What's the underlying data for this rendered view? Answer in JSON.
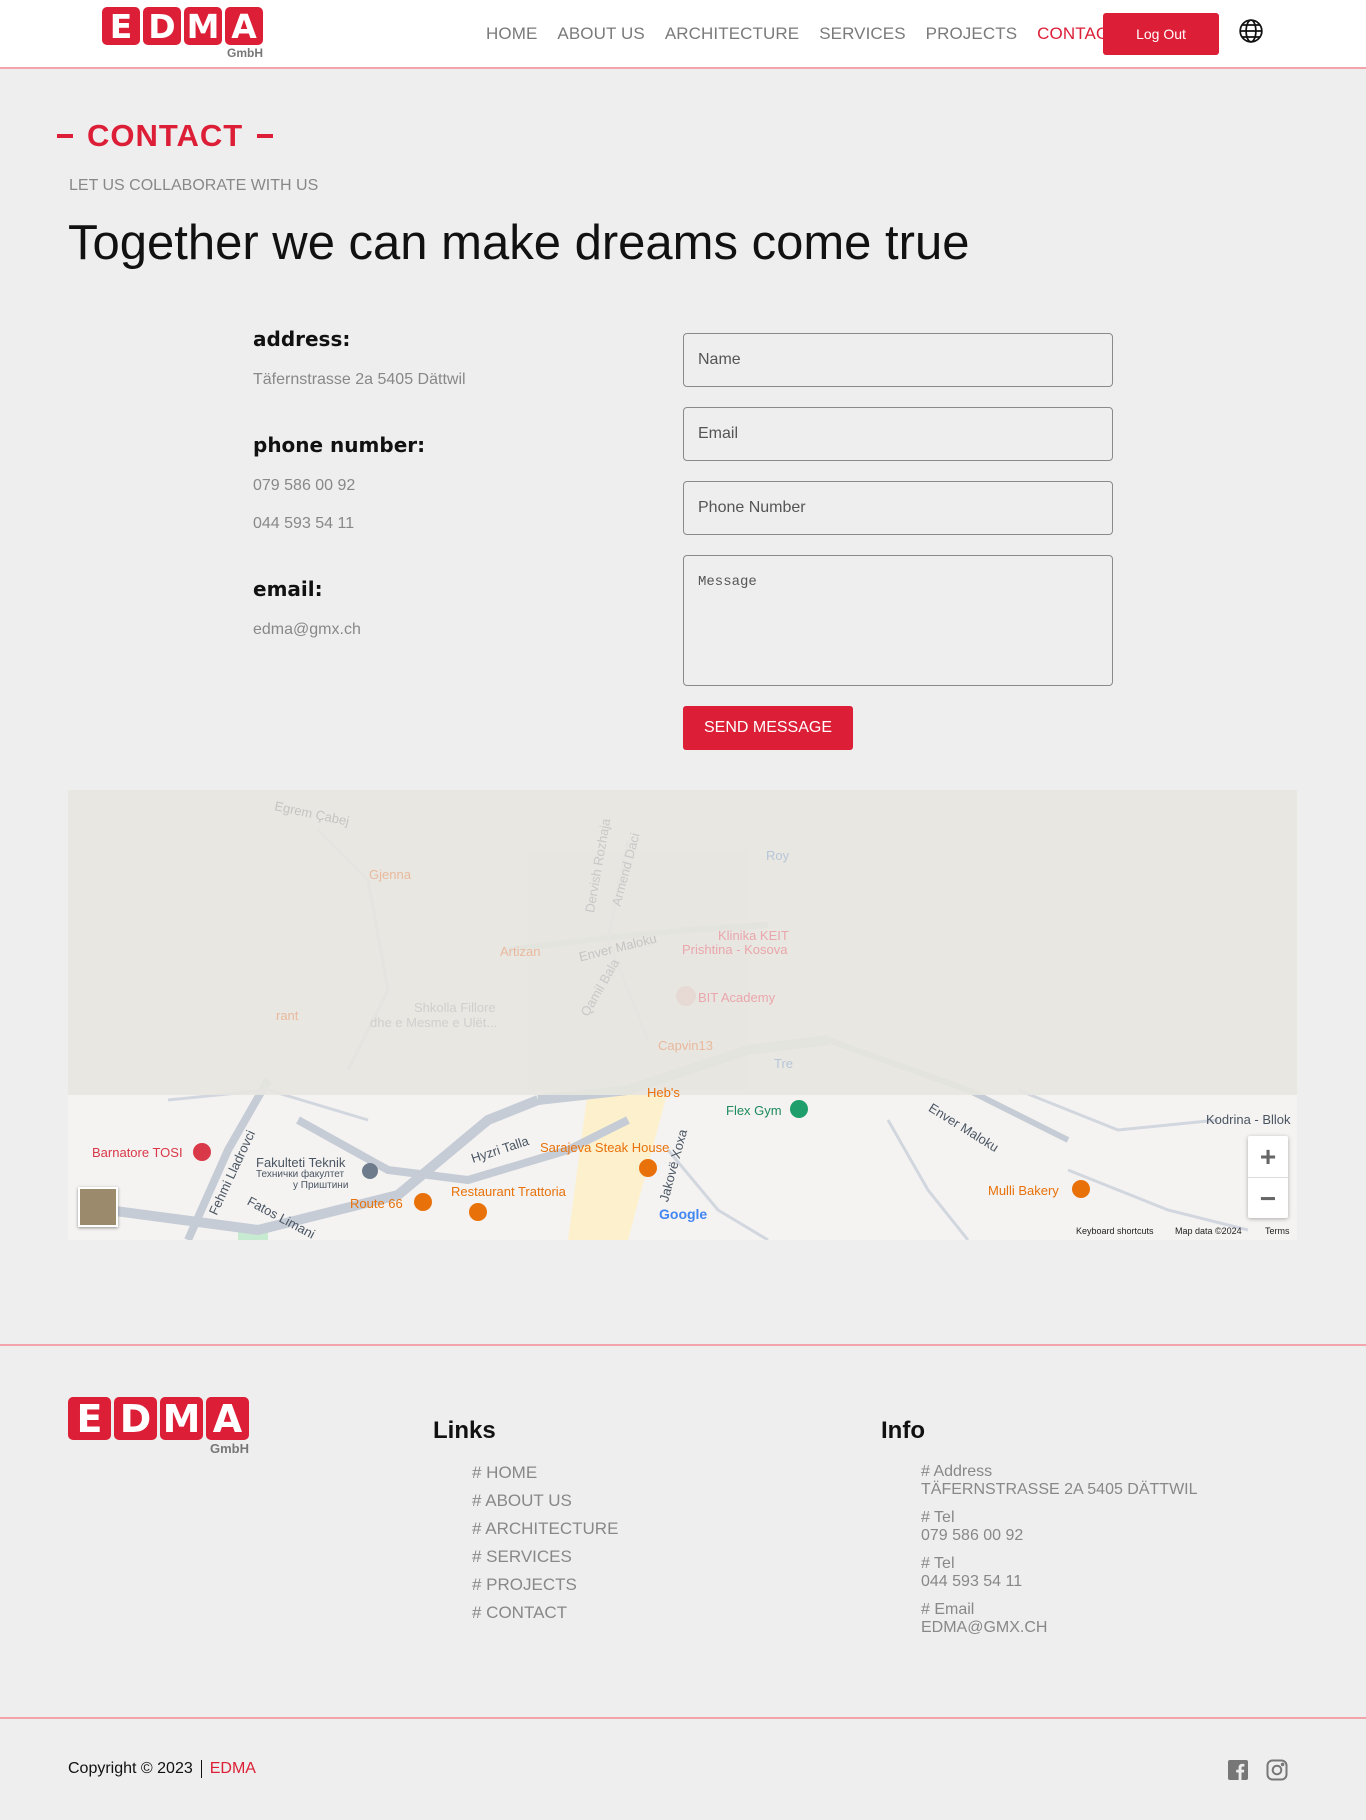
{
  "header": {
    "logo_letters": [
      "E",
      "D",
      "M",
      "A"
    ],
    "logo_sub": "GmbH",
    "nav": [
      {
        "label": "HOME",
        "active": false
      },
      {
        "label": "ABOUT US",
        "active": false
      },
      {
        "label": "ARCHITECTURE",
        "active": false
      },
      {
        "label": "SERVICES",
        "active": false
      },
      {
        "label": "PROJECTS",
        "active": false
      },
      {
        "label": "CONTACT",
        "active": true
      }
    ],
    "logout_label": "Log Out",
    "language_icon": "globe-icon"
  },
  "section": {
    "tag": "CONTACT",
    "subtitle": "LET US COLLABORATE WITH US",
    "headline": "Together we can make dreams come true"
  },
  "info": {
    "address_label": "address:",
    "address_value": "Täfernstrasse 2a 5405 Dättwil",
    "phone_label": "phone number:",
    "phone_1": "079 586 00 92",
    "phone_2": "044 593 54 11",
    "email_label": "email:",
    "email_value": "edma@gmx.ch"
  },
  "form": {
    "name_placeholder": "Name",
    "email_placeholder": "Email",
    "phone_placeholder": "Phone Number",
    "message_placeholder": "Message",
    "send_label": "SEND MESSAGE"
  },
  "map": {
    "labels": {
      "egrem": "Egrem Çabej",
      "derviah": "Dervish Rozhaja",
      "armend": "Armend Daci",
      "roy": "Roy",
      "gjenna": "Gjenna",
      "artizan": "Artizan",
      "enver": "Enver Maloku",
      "klinika": "Klinika KEIT",
      "klinika2": "Prishtina - Kosova",
      "qamil": "Qamil Bala",
      "shkolla": "Shkolla Fillore",
      "shkolla2": "dhe e Mesme e Ulët...",
      "bit": "BIT Academy",
      "capvin": "Capvin13",
      "rant": "rant",
      "hebs": "Heb's",
      "flex": "Flex Gym",
      "enver2": "Enver Maloku",
      "kodrina": "Kodrina - Bllok",
      "barnatore": "Barnatore TOSI",
      "fehmi": "Fehmi Lladrovci",
      "fakulteti": "Fakulteti Teknik",
      "fakulteti2": "Технички факултет",
      "fakulteti3": "у Приштини",
      "hyzri": "Hyzri Talla",
      "sarajeva": "Sarajeva Steak House",
      "jakove": "Jakovë Xoxa",
      "trattoria": "Restaurant Trattoria",
      "route66": "Route 66",
      "fatos": "Fatos Limani",
      "mulli": "Mulli Bakery",
      "tre": "Tre"
    },
    "google": "Google",
    "keyboard": "Keyboard shortcuts",
    "mapdata": "Map data ©2024",
    "terms": "Terms",
    "zoom_in": "+",
    "zoom_out": "−"
  },
  "footer": {
    "links_heading": "Links",
    "links": [
      "# HOME",
      "# ABOUT US",
      "# ARCHITECTURE",
      "# SERVICES",
      "# PROJECTS",
      "# CONTACT"
    ],
    "info_heading": "Info",
    "info": [
      {
        "label": "# Address",
        "value": "TÄFERNSTRASSE 2A 5405 DÄTTWIL"
      },
      {
        "label": "# Tel",
        "value": "079 586 00 92"
      },
      {
        "label": "# Tel",
        "value": "044 593 54 11"
      },
      {
        "label": "# Email",
        "value": "EDMA@GMX.CH"
      }
    ],
    "copyright": "Copyright © 2023",
    "brand": "EDMA"
  },
  "colors": {
    "accent": "#dc1e36",
    "divider": "#f2a3ab",
    "background": "#eeeeee"
  }
}
